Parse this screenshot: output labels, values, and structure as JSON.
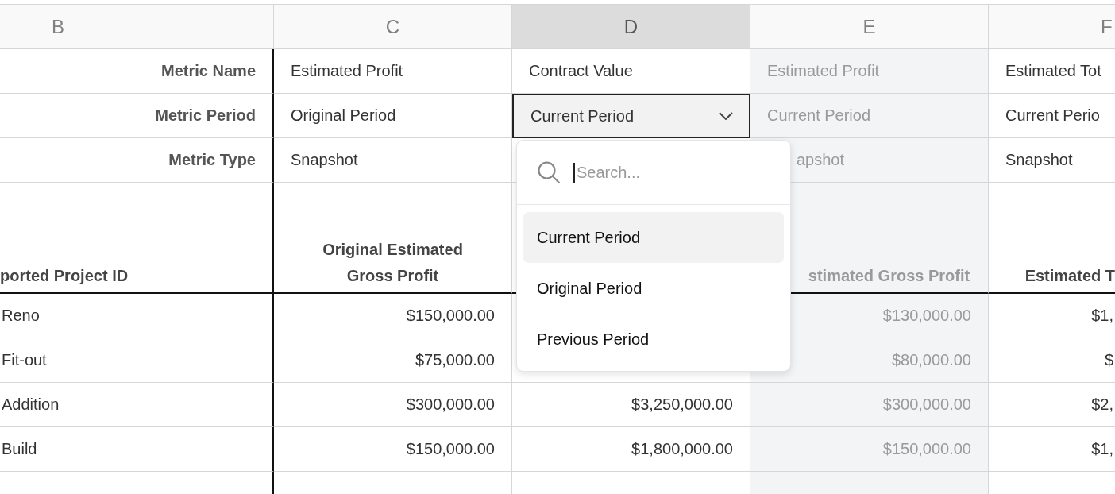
{
  "columns": [
    {
      "letter": "B",
      "selected": false,
      "disabled": false
    },
    {
      "letter": "C",
      "selected": false,
      "disabled": false
    },
    {
      "letter": "D",
      "selected": true,
      "disabled": false
    },
    {
      "letter": "E",
      "selected": false,
      "disabled": true
    },
    {
      "letter": "F",
      "selected": false,
      "disabled": false
    }
  ],
  "metric_rows": [
    {
      "label": "Metric Name",
      "cells": [
        {
          "kind": "text",
          "text": "Estimated Profit"
        },
        {
          "kind": "text",
          "text": "Contract Value"
        },
        {
          "kind": "text",
          "text": "Estimated Profit"
        },
        {
          "kind": "text",
          "text": "Estimated Tot"
        }
      ]
    },
    {
      "label": "Metric Period",
      "cells": [
        {
          "kind": "text",
          "text": "Original Period"
        },
        {
          "kind": "select",
          "value": "Current Period"
        },
        {
          "kind": "text",
          "text": "Current Period"
        },
        {
          "kind": "text",
          "text": "Current Perio"
        }
      ]
    },
    {
      "label": "Metric Type",
      "cells": [
        {
          "kind": "text",
          "text": "Snapshot"
        },
        {
          "kind": "hidden"
        },
        {
          "kind": "text",
          "text": "apshot"
        },
        {
          "kind": "text",
          "text": "Snapshot"
        }
      ]
    }
  ],
  "headers": [
    {
      "kind": "text",
      "text": "ported Project ID"
    },
    {
      "kind": "text",
      "text": "Original Estimated Gross Profit"
    },
    {
      "kind": "hidden"
    },
    {
      "kind": "text",
      "text": "stimated Gross Profit"
    },
    {
      "kind": "text",
      "text": "Estimated T"
    }
  ],
  "rows": [
    [
      {
        "kind": "text",
        "text": "Reno"
      },
      {
        "kind": "text",
        "text": "$150,000.00"
      },
      {
        "kind": "hidden"
      },
      {
        "kind": "text",
        "text": "$130,000.00"
      },
      {
        "kind": "text",
        "text": "$1,"
      }
    ],
    [
      {
        "kind": "text",
        "text": "Fit-out"
      },
      {
        "kind": "text",
        "text": "$75,000.00"
      },
      {
        "kind": "hidden"
      },
      {
        "kind": "text",
        "text": "$80,000.00"
      },
      {
        "kind": "text",
        "text": "$"
      }
    ],
    [
      {
        "kind": "text",
        "text": "Addition"
      },
      {
        "kind": "text",
        "text": "$300,000.00"
      },
      {
        "kind": "text",
        "text": "$3,250,000.00"
      },
      {
        "kind": "text",
        "text": "$300,000.00"
      },
      {
        "kind": "text",
        "text": "$2,"
      }
    ],
    [
      {
        "kind": "text",
        "text": "Build"
      },
      {
        "kind": "text",
        "text": "$150,000.00"
      },
      {
        "kind": "text",
        "text": "$1,800,000.00"
      },
      {
        "kind": "text",
        "text": "$150,000.00"
      },
      {
        "kind": "text",
        "text": "$1,"
      }
    ]
  ],
  "dropdown": {
    "open": true,
    "search_placeholder": "Search...",
    "options": [
      {
        "label": "Current Period",
        "selected": true
      },
      {
        "label": "Original Period",
        "selected": false
      },
      {
        "label": "Previous Period",
        "selected": false
      }
    ]
  }
}
